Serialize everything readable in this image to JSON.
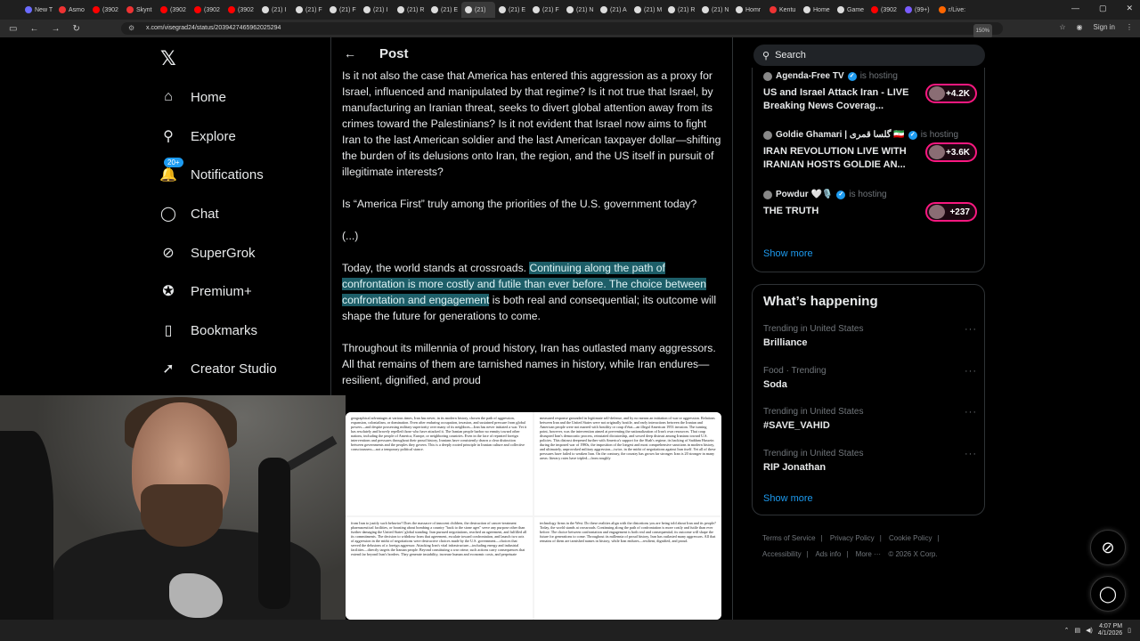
{
  "browser": {
    "tabs": [
      {
        "label": "New T",
        "color": "#6b6bff"
      },
      {
        "label": "Asmo",
        "color": "#e33"
      },
      {
        "label": "(3902",
        "color": "#f00"
      },
      {
        "label": "Skynt",
        "color": "#e33"
      },
      {
        "label": "(3902",
        "color": "#f00"
      },
      {
        "label": "(3902",
        "color": "#f00"
      },
      {
        "label": "(3902",
        "color": "#f00"
      },
      {
        "label": "(21) I",
        "color": "#ddd"
      },
      {
        "label": "(21) F",
        "color": "#ddd"
      },
      {
        "label": "(21) F",
        "color": "#ddd"
      },
      {
        "label": "(21) I",
        "color": "#ddd"
      },
      {
        "label": "(21) R",
        "color": "#ddd"
      },
      {
        "label": "(21) E",
        "color": "#ddd"
      },
      {
        "label": "(21)",
        "color": "#ddd",
        "active": true
      },
      {
        "label": "(21) E",
        "color": "#ddd"
      },
      {
        "label": "(21) F",
        "color": "#ddd"
      },
      {
        "label": "(21) N",
        "color": "#ddd"
      },
      {
        "label": "(21) A",
        "color": "#ddd"
      },
      {
        "label": "(21) M",
        "color": "#ddd"
      },
      {
        "label": "(21) R",
        "color": "#ddd"
      },
      {
        "label": "(21) N",
        "color": "#ddd"
      },
      {
        "label": "Homr",
        "color": "#ddd"
      },
      {
        "label": "Kentu",
        "color": "#e33"
      },
      {
        "label": "Home",
        "color": "#ddd"
      },
      {
        "label": "Game",
        "color": "#ddd"
      },
      {
        "label": "(3902",
        "color": "#f00"
      },
      {
        "label": "(99+)",
        "color": "#7a5cff"
      },
      {
        "label": "r/Live:",
        "color": "#f60"
      }
    ],
    "url": "x.com/visegrad24/status/2039427465962025294",
    "zoom": "150%",
    "sign_in": "Sign in"
  },
  "sidebar": {
    "logo": "𝕏",
    "items": [
      {
        "label": "Home",
        "icon": "home-icon",
        "glyph": "⌂"
      },
      {
        "label": "Explore",
        "icon": "search-icon",
        "glyph": "⚲"
      },
      {
        "label": "Notifications",
        "icon": "bell-icon",
        "glyph": "🔔",
        "badge": "20+"
      },
      {
        "label": "Chat",
        "icon": "chat-icon",
        "glyph": "◯"
      },
      {
        "label": "SuperGrok",
        "icon": "grok-icon",
        "glyph": "⊘"
      },
      {
        "label": "Premium+",
        "icon": "verified-icon",
        "glyph": "✪"
      },
      {
        "label": "Bookmarks",
        "icon": "bookmark-icon",
        "glyph": "▯"
      },
      {
        "label": "Creator Studio",
        "icon": "rocket-icon",
        "glyph": "➚"
      }
    ]
  },
  "post": {
    "title": "Post",
    "p1": "Is it not also the case that America has entered this aggression as a proxy for Israel, influenced and manipulated by that regime? Is it not true that Israel, by manufacturing an Iranian threat, seeks to divert global attention away from its crimes toward the Palestinians? Is it not evident that Israel now aims to fight Iran to the last American soldier and the last American taxpayer dollar—shifting the burden of its delusions onto Iran, the region, and the US itself in pursuit of illegitimate interests?",
    "p2": "Is “America First” truly among the priorities of the U.S. government today?",
    "p3": "(...)",
    "p4_pre": "Today, the world stands at crossroads. ",
    "p4_highlight": "Continuing along the path of confrontation is more costly and futile than ever before. The choice between confrontation and engagement",
    "p4_post": " is both real and consequential; its outcome will shape the future for generations to come.",
    "p5": "Throughout its millennia of proud history, Iran has outlasted many aggressors. All that remains of them are tarnished names in history, while Iran endures—resilient, dignified, and proud",
    "doc_pages": [
      "geographical advantages at various times, Iran has never, in its modern history, chosen the path of aggression, expansion, colonialism, or domination. Even after enduring occupation, invasion, and sustained pressure from global powers—and despite possessing military superiority over many of its neighbors—Iran has never initiated a war. Yet it has resolutely and bravely repelled those who have attacked it. The Iranian people harbor no enmity toward other nations, including the people of America, Europe, or neighboring countries. Even in the face of repeated foreign interventions and pressures throughout their proud history, Iranians have consistently drawn a clear distinction between governments and the peoples they govern. This is a deeply rooted principle in Iranian culture and collective consciousness—not a temporary political stance.",
      "measured response grounded in legitimate self-defense, and by no means an initiation of war or aggression. Relations between Iran and the United States were not originally hostile, and early interactions between the Iranian and American people were not marred with hostility or coup d'état—an illegal American 1953 invasion. The turning point, however, was the intervention aimed at preventing the nationalization of Iran's own resources. That coup disrupted Iran's democratic process, reinstated dictatorship, and sowed deep distrust among Iranians toward U.S. policies. This distrust deepened further with America's support for the Shah's regime, its backing of Saddam Hussein during the imposed war of 1980s, the imposition of the longest and most comprehensive sanctions in modern history, and ultimately, unprovoked military aggression—twice, in the midst of negotiations against Iran itself. Yet all of these pressures have failed to weaken Iran. On the contrary, the country has grown far stronger. Iran is 20 stronger in many areas: literacy rates have tripled—from roughly",
      "from Iran to justify such behavior? Does the massacre of innocent children, the destruction of cancer-treatment pharmaceutical facilities, or boasting about bombing a country \"back to the stone ages\" serve any purpose other than further damaging the United States' global standing. Iran pursued negotiations, reached an agreement, and fulfilled all its commitments. The decision to withdraw from that agreement, escalate toward confrontation, and launch two acts of aggression in the midst of negotiations were destructive choices made by the U.S. government—choices that served the delusions of a foreign aggressor. Attacking Iran's vital infrastructure—including energy and industrial facilities—directly targets the Iranian people. Beyond constituting a war crime, such actions carry consequences that extend far beyond Iran's borders. They generate instability, increase human and economic costs, and perpetuate",
      "technology firms in the West. Do these realities align with the distortions you are being told about Iran and its people? Today, the world stands at crossroads. Continuing along the path of confrontation is more costly and futile than ever before. The choice between confrontation and engagement is both real and consequential; its outcome will shape the future for generations to come. Throughout its millennia of proud history, Iran has outlasted many aggressors. All that remains of them are tarnished names in history, while Iran endures—resilient, dignified, and proud."
    ]
  },
  "right": {
    "search_placeholder": "Search",
    "spaces": [
      {
        "host": "Agenda-Free TV",
        "hosting": "is hosting",
        "title": "US and Israel Attack Iran - LIVE Breaking News Coverag...",
        "listeners": "+4.2K"
      },
      {
        "host": "Goldie Ghamari | گلسا قمری 🇮🇷",
        "hosting": "is hosting",
        "title": "IRAN REVOLUTION LIVE WITH IRANIAN HOSTS GOLDIE AN...",
        "listeners": "+3.6K"
      },
      {
        "host": "Powdur 🤍🎙️",
        "hosting": "is hosting",
        "title": "THE TRUTH",
        "listeners": "+237"
      }
    ],
    "spaces_show_more": "Show more",
    "happening_title": "What’s happening",
    "trends": [
      {
        "meta": "Trending in United States",
        "name": "Brilliance"
      },
      {
        "meta": "Food · Trending",
        "name": "Soda"
      },
      {
        "meta": "Trending in United States",
        "name": "#SAVE_VAHID"
      },
      {
        "meta": "Trending in United States",
        "name": "RIP Jonathan"
      }
    ],
    "trends_show_more": "Show more",
    "footer": {
      "links": [
        "Terms of Service",
        "Privacy Policy",
        "Cookie Policy",
        "Accessibility",
        "Ads info",
        "More ···"
      ],
      "copyright": "© 2026 X Corp."
    }
  },
  "taskbar": {
    "time": "4:07 PM",
    "date": "4/1/2026"
  },
  "colors": {
    "accent": "#1d9bf0",
    "highlight": "#1d5e68",
    "spaces_ring": "#f91880"
  }
}
